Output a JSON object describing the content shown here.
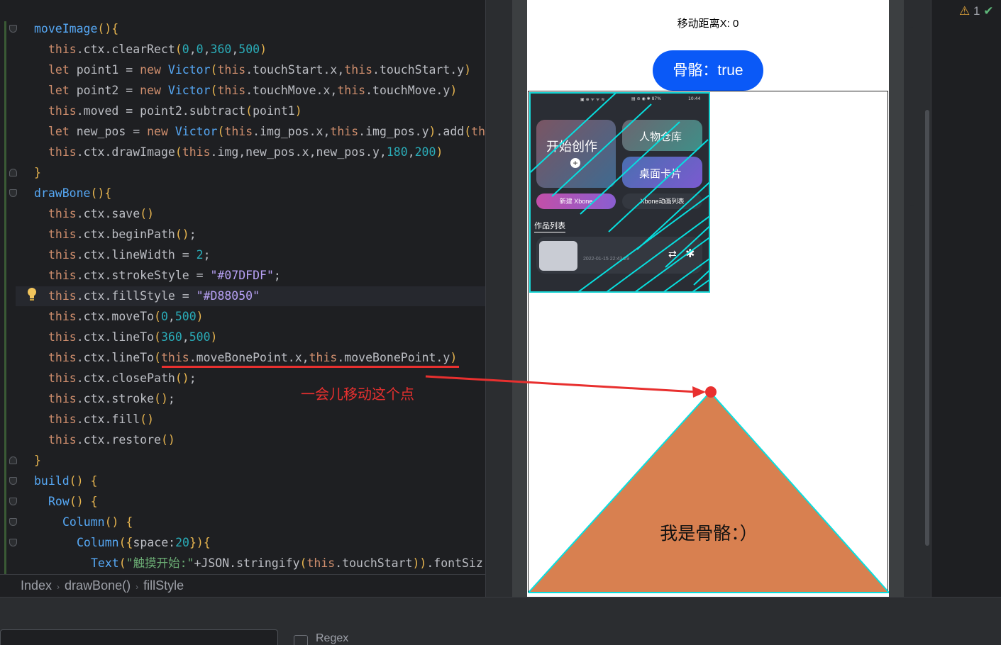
{
  "editor": {
    "lines": [
      {
        "indent": 0,
        "tokens": [
          [
            "f",
            "moveImage"
          ],
          [
            "p",
            "(){"
          ]
        ]
      },
      {
        "indent": 1,
        "tokens": [
          [
            "k",
            "this"
          ],
          [
            "w",
            ".ctx.clearRect"
          ],
          [
            "p",
            "("
          ],
          [
            "n",
            "0"
          ],
          [
            "w",
            ","
          ],
          [
            "n",
            "0"
          ],
          [
            "w",
            ","
          ],
          [
            "n",
            "360"
          ],
          [
            "w",
            ","
          ],
          [
            "n",
            "500"
          ],
          [
            "p",
            ")"
          ]
        ]
      },
      {
        "indent": 1,
        "tokens": [
          [
            "k",
            "let "
          ],
          [
            "w",
            "point1 = "
          ],
          [
            "k",
            "new "
          ],
          [
            "f",
            "Victor"
          ],
          [
            "p",
            "("
          ],
          [
            "k",
            "this"
          ],
          [
            "w",
            ".touchStart.x,"
          ],
          [
            "k",
            "this"
          ],
          [
            "w",
            ".touchStart.y"
          ],
          [
            "p",
            ")"
          ]
        ]
      },
      {
        "indent": 1,
        "tokens": [
          [
            "k",
            "let "
          ],
          [
            "w",
            "point2 = "
          ],
          [
            "k",
            "new "
          ],
          [
            "f",
            "Victor"
          ],
          [
            "p",
            "("
          ],
          [
            "k",
            "this"
          ],
          [
            "w",
            ".touchMove.x,"
          ],
          [
            "k",
            "this"
          ],
          [
            "w",
            ".touchMove.y"
          ],
          [
            "p",
            ")"
          ]
        ]
      },
      {
        "indent": 1,
        "tokens": [
          [
            "k",
            "this"
          ],
          [
            "w",
            ".moved = point2.subtract"
          ],
          [
            "p",
            "("
          ],
          [
            "w",
            "point1"
          ],
          [
            "p",
            ")"
          ]
        ]
      },
      {
        "indent": 1,
        "tokens": [
          [
            "k",
            "let "
          ],
          [
            "w",
            "new_pos = "
          ],
          [
            "k",
            "new "
          ],
          [
            "f",
            "Victor"
          ],
          [
            "p",
            "("
          ],
          [
            "k",
            "this"
          ],
          [
            "w",
            ".img_pos.x,"
          ],
          [
            "k",
            "this"
          ],
          [
            "w",
            ".img_pos.y"
          ],
          [
            "p",
            ")"
          ],
          [
            "w",
            ".add"
          ],
          [
            "p",
            "("
          ],
          [
            "k",
            "this"
          ]
        ]
      },
      {
        "indent": 1,
        "tokens": [
          [
            "k",
            "this"
          ],
          [
            "w",
            ".ctx.drawImage"
          ],
          [
            "p",
            "("
          ],
          [
            "k",
            "this"
          ],
          [
            "w",
            ".img,new_pos.x,new_pos.y,"
          ],
          [
            "n",
            "180"
          ],
          [
            "w",
            ","
          ],
          [
            "n",
            "200"
          ],
          [
            "p",
            ")"
          ]
        ]
      },
      {
        "indent": 0,
        "tokens": [
          [
            "p",
            "}"
          ]
        ]
      },
      {
        "indent": 0,
        "tokens": [
          [
            "f",
            "drawBone"
          ],
          [
            "p",
            "(){"
          ]
        ]
      },
      {
        "indent": 1,
        "tokens": [
          [
            "k",
            "this"
          ],
          [
            "w",
            ".ctx.save"
          ],
          [
            "p",
            "()"
          ]
        ]
      },
      {
        "indent": 1,
        "tokens": [
          [
            "k",
            "this"
          ],
          [
            "w",
            ".ctx.beginPath"
          ],
          [
            "p",
            "()"
          ],
          [
            "w",
            ";"
          ]
        ]
      },
      {
        "indent": 1,
        "tokens": [
          [
            "k",
            "this"
          ],
          [
            "w",
            ".ctx.lineWidth = "
          ],
          [
            "n",
            "2"
          ],
          [
            "w",
            ";"
          ]
        ]
      },
      {
        "indent": 1,
        "tokens": [
          [
            "k",
            "this"
          ],
          [
            "w",
            ".ctx.strokeStyle = "
          ],
          [
            "sv",
            "\"#07DFDF\""
          ],
          [
            "w",
            ";"
          ]
        ]
      },
      {
        "indent": 1,
        "tokens": [
          [
            "k",
            "this"
          ],
          [
            "w",
            ".ctx.fillStyle = "
          ],
          [
            "sv",
            "\"#D88050\""
          ]
        ]
      },
      {
        "indent": 1,
        "tokens": [
          [
            "k",
            "this"
          ],
          [
            "w",
            ".ctx.moveTo"
          ],
          [
            "p",
            "("
          ],
          [
            "n",
            "0"
          ],
          [
            "w",
            ","
          ],
          [
            "n",
            "500"
          ],
          [
            "p",
            ")"
          ]
        ]
      },
      {
        "indent": 1,
        "tokens": [
          [
            "k",
            "this"
          ],
          [
            "w",
            ".ctx.lineTo"
          ],
          [
            "p",
            "("
          ],
          [
            "n",
            "360"
          ],
          [
            "w",
            ","
          ],
          [
            "n",
            "500"
          ],
          [
            "p",
            ")"
          ]
        ]
      },
      {
        "indent": 1,
        "tokens": [
          [
            "k",
            "this"
          ],
          [
            "w",
            ".ctx.lineTo"
          ],
          [
            "p",
            "("
          ],
          [
            "k",
            "this"
          ],
          [
            "w",
            ".moveBonePoint.x,"
          ],
          [
            "k",
            "this"
          ],
          [
            "w",
            ".moveBonePoint.y"
          ],
          [
            "p",
            ")"
          ]
        ]
      },
      {
        "indent": 1,
        "tokens": [
          [
            "k",
            "this"
          ],
          [
            "w",
            ".ctx.closePath"
          ],
          [
            "p",
            "()"
          ],
          [
            "w",
            ";"
          ]
        ]
      },
      {
        "indent": 1,
        "tokens": [
          [
            "k",
            "this"
          ],
          [
            "w",
            ".ctx.stroke"
          ],
          [
            "p",
            "()"
          ],
          [
            "w",
            ";"
          ]
        ]
      },
      {
        "indent": 1,
        "tokens": [
          [
            "k",
            "this"
          ],
          [
            "w",
            ".ctx.fill"
          ],
          [
            "p",
            "()"
          ]
        ]
      },
      {
        "indent": 1,
        "tokens": [
          [
            "k",
            "this"
          ],
          [
            "w",
            ".ctx.restore"
          ],
          [
            "p",
            "()"
          ]
        ]
      },
      {
        "indent": 0,
        "tokens": [
          [
            "p",
            "}"
          ]
        ]
      },
      {
        "indent": 0,
        "tokens": [
          [
            "f",
            "build"
          ],
          [
            "p",
            "() {"
          ]
        ]
      },
      {
        "indent": 1,
        "tokens": [
          [
            "f",
            "Row"
          ],
          [
            "p",
            "() {"
          ]
        ]
      },
      {
        "indent": 2,
        "tokens": [
          [
            "f",
            "Column"
          ],
          [
            "p",
            "() {"
          ]
        ]
      },
      {
        "indent": 3,
        "tokens": [
          [
            "f",
            "Column"
          ],
          [
            "p",
            "({"
          ],
          [
            "w",
            "space:"
          ],
          [
            "n",
            "20"
          ],
          [
            "p",
            "}){"
          ]
        ]
      },
      {
        "indent": 4,
        "tokens": [
          [
            "f",
            "Text"
          ],
          [
            "p",
            "("
          ],
          [
            "s",
            "\"触摸开始:\""
          ],
          [
            "w",
            "+JSON.stringify"
          ],
          [
            "p",
            "("
          ],
          [
            "k",
            "this"
          ],
          [
            "w",
            ".touchStart"
          ],
          [
            "p",
            "))"
          ],
          [
            "w",
            ".fontSiz"
          ]
        ]
      }
    ],
    "annotation": "一会儿移动这个点"
  },
  "breadcrumb": [
    "Index",
    "drawBone()",
    "fillStyle"
  ],
  "search": {
    "regex_label": "Regex"
  },
  "preview": {
    "move_label": "移动距离X: 0",
    "bone_button": "骨骼：true",
    "triangle_label": "我是骨骼：）",
    "app": {
      "status_left": "▣ ⊕ ᯤ ᯤ ≋",
      "status_right": "▤ ⊘ ◉ ✱ 87%",
      "battery": "10:44",
      "create": "开始创作",
      "people": "人物仓库",
      "desktop": "桌面卡片",
      "new_xbone": "新建 Xbone",
      "xbone_list": "Xbone动画列表",
      "works": "作品列表",
      "work_date": "2022-01-15 22:43:29"
    }
  },
  "inspections": {
    "warnings": "1"
  },
  "colors": {
    "stroke": "#07DFDF",
    "fill": "#D88050",
    "button": "#0A59F7",
    "annotation": "#E8302F"
  }
}
